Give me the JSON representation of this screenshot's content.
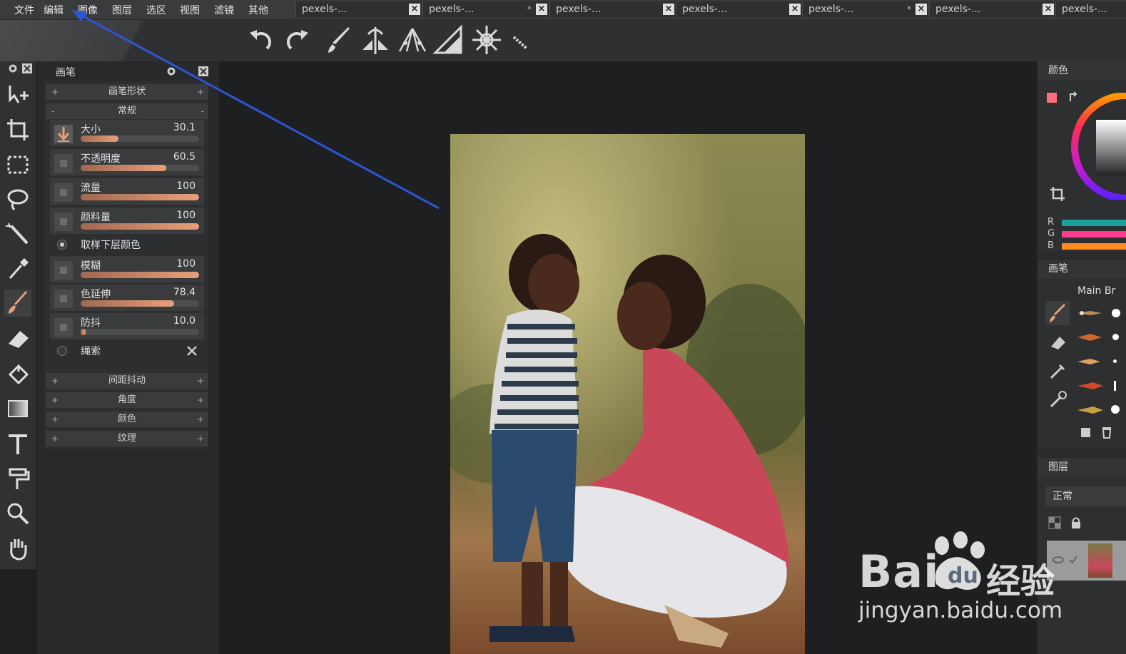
{
  "menu": {
    "items": [
      {
        "label": "文件"
      },
      {
        "label": "编辑"
      },
      {
        "label": "图像"
      },
      {
        "label": "图层"
      },
      {
        "label": "选区"
      },
      {
        "label": "视图"
      },
      {
        "label": "滤镜"
      },
      {
        "label": "其他"
      }
    ]
  },
  "tabs": [
    {
      "label": "pexels-...",
      "modified": "",
      "close": "×"
    },
    {
      "label": "pexels-...",
      "modified": "*",
      "close": "×"
    },
    {
      "label": "pexels-...",
      "modified": "",
      "close": "×"
    },
    {
      "label": "pexels-...",
      "modified": "",
      "close": "×"
    },
    {
      "label": "pexels-...",
      "modified": "*",
      "close": "×"
    },
    {
      "label": "pexels-...",
      "modified": "",
      "close": "×"
    },
    {
      "label": "pexels-...",
      "modified": "",
      "close": ""
    }
  ],
  "toolbar": {
    "icons": [
      "undo-icon",
      "redo-icon",
      "brush-stroke-icon",
      "symmetry-icon",
      "perspective-icon",
      "ruler-icon",
      "mandala-icon",
      "pencil-small-icon"
    ]
  },
  "tools": [
    "move-icon",
    "crop-icon",
    "rect-select-icon",
    "lasso-icon",
    "magic-wand-icon",
    "eyedropper-icon",
    "brush-icon",
    "eraser-icon",
    "fill-icon",
    "gradient-icon",
    "text-icon",
    "smudge-icon",
    "zoom-icon",
    "hand-icon"
  ],
  "brush_panel": {
    "title": "画笔",
    "sections": {
      "shape": "画笔形状",
      "general": "常规",
      "spacing_jitter": "间距抖动",
      "angle": "角度",
      "color": "颜色",
      "texture": "纹理"
    },
    "plus": "+",
    "minus": "-",
    "sliders": [
      {
        "label": "大小",
        "value": "30.1",
        "fraction": 0.32
      },
      {
        "label": "不透明度",
        "value": "60.5",
        "fraction": 0.72
      },
      {
        "label": "流量",
        "value": "100",
        "fraction": 1.0
      },
      {
        "label": "颜料量",
        "value": "100",
        "fraction": 1.0
      },
      {
        "label": "模糊",
        "value": "100",
        "fraction": 1.0
      },
      {
        "label": "色延伸",
        "value": "78.4",
        "fraction": 0.79
      },
      {
        "label": "防抖",
        "value": "10.0",
        "fraction": 0.04
      }
    ],
    "sample_below": "取样下层颜色",
    "lasso": "绳索"
  },
  "right_panel": {
    "color_title": "颜色",
    "rgb_labels": [
      "R",
      "G",
      "B"
    ],
    "rgb_colors": [
      "#1aa19a",
      "#ff3f8e",
      "#ff8a1f"
    ],
    "brush_title": "画笔",
    "brush_set_name": "Main Br",
    "layers_title": "图层",
    "blend_mode": "正常"
  },
  "watermark": {
    "brand": "Bai",
    "brand2": "经验",
    "url": "jingyan.baidu.com"
  },
  "colors": {
    "accent_brush": "#e8a07a",
    "annotation_arrow": "#2d55d6"
  }
}
